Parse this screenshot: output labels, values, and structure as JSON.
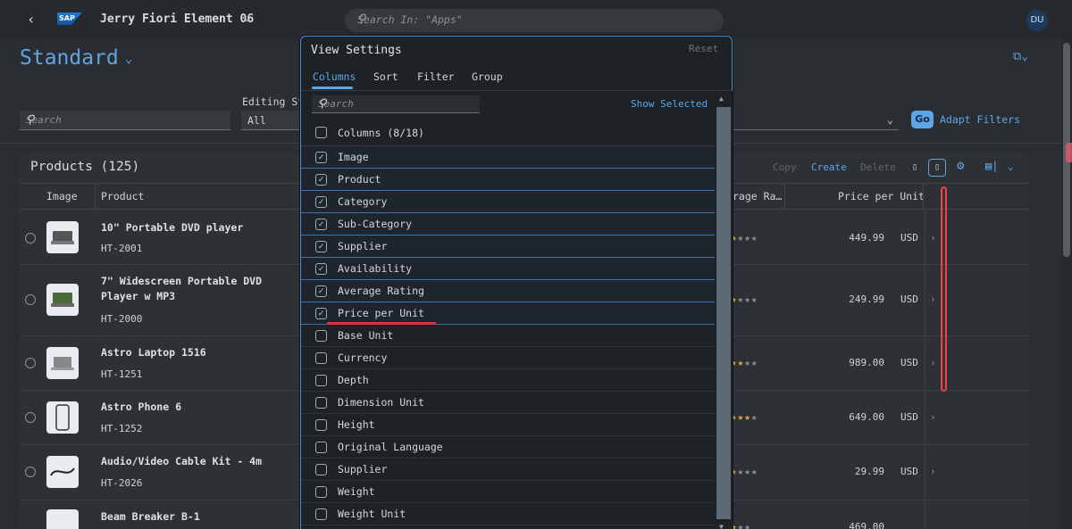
{
  "shell": {
    "logo": "SAP",
    "app_title": "Jerry Fiori Element 06",
    "search_placeholder": "Search In: \"Apps\"",
    "avatar": "DU"
  },
  "header": {
    "variant": "Standard"
  },
  "filters": {
    "search_placeholder": "Search",
    "editing_status_label": "Editing St",
    "editing_status_value": "All",
    "go_label": "Go",
    "adapt_label": "Adapt Filters"
  },
  "table": {
    "title": "Products (125)",
    "toolbar": {
      "copy": "Copy",
      "create": "Create",
      "delete": "Delete"
    },
    "columns": {
      "image": "Image",
      "product": "Product",
      "rating": "rage Ra…",
      "price": "Price per Unit"
    },
    "rows": [
      {
        "name": "10\" Portable DVD player",
        "code": "HT-2001",
        "rating": 1,
        "price": "449.99",
        "currency": "USD"
      },
      {
        "name": "7\" Widescreen Portable DVD Player w MP3",
        "code": "HT-2000",
        "rating": 1,
        "price": "249.99",
        "currency": "USD"
      },
      {
        "name": "Astro Laptop 1516",
        "code": "HT-1251",
        "rating": 2,
        "price": "989.00",
        "currency": "USD"
      },
      {
        "name": "Astro Phone 6",
        "code": "HT-1252",
        "rating": 3,
        "price": "649.00",
        "currency": "USD"
      },
      {
        "name": "Audio/Video Cable Kit - 4m",
        "code": "HT-2026",
        "rating": 1,
        "price": "29.99",
        "currency": "USD"
      },
      {
        "name": "Beam Breaker B-1",
        "code": "",
        "rating": 1,
        "price": "469.00",
        "currency": ""
      }
    ]
  },
  "dialog": {
    "title": "View Settings",
    "reset": "Reset",
    "tabs": [
      "Columns",
      "Sort",
      "Filter",
      "Group"
    ],
    "search_placeholder": "Search",
    "show_selected": "Show Selected",
    "header_label": "Columns (8/18)",
    "items": [
      {
        "label": "Image",
        "checked": true
      },
      {
        "label": "Product",
        "checked": true
      },
      {
        "label": "Category",
        "checked": true
      },
      {
        "label": "Sub-Category",
        "checked": true
      },
      {
        "label": "Supplier",
        "checked": true
      },
      {
        "label": "Availability",
        "checked": true
      },
      {
        "label": "Average Rating",
        "checked": true
      },
      {
        "label": "Price per Unit",
        "checked": true
      },
      {
        "label": "Base Unit",
        "checked": false
      },
      {
        "label": "Currency",
        "checked": false
      },
      {
        "label": "Depth",
        "checked": false
      },
      {
        "label": "Dimension Unit",
        "checked": false
      },
      {
        "label": "Height",
        "checked": false
      },
      {
        "label": "Original Language",
        "checked": false
      },
      {
        "label": "Supplier",
        "checked": false
      },
      {
        "label": "Weight",
        "checked": false
      },
      {
        "label": "Weight Unit",
        "checked": false
      }
    ]
  },
  "colors": {
    "accent": "#5ea5e8",
    "star": "#e7a73b",
    "highlight": "#e3303e"
  }
}
